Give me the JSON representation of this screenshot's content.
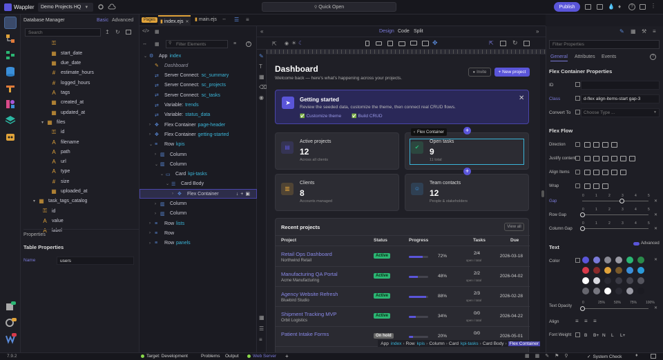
{
  "topbar": {
    "brand": "Wappler",
    "project": "Demo Projects HQ",
    "quick_open": "Quick Open",
    "publish": "Publish"
  },
  "db": {
    "title": "Database Manager",
    "basic": "Basic",
    "advanced": "Advanced",
    "search_placeholder": "Search",
    "fields": [
      {
        "icon": "key",
        "label": ""
      },
      {
        "icon": "date",
        "label": "start_date"
      },
      {
        "icon": "date",
        "label": "due_date"
      },
      {
        "icon": "hash",
        "label": "estimate_hours"
      },
      {
        "icon": "hash",
        "label": "logged_hours"
      },
      {
        "icon": "text",
        "label": "tags"
      },
      {
        "icon": "date",
        "label": "created_at"
      },
      {
        "icon": "date",
        "label": "updated_at"
      }
    ],
    "files_table": "files",
    "files_fields": [
      {
        "icon": "key",
        "label": "id"
      },
      {
        "icon": "text",
        "label": "filename"
      },
      {
        "icon": "text",
        "label": "path"
      },
      {
        "icon": "text",
        "label": "url"
      },
      {
        "icon": "text",
        "label": "type"
      },
      {
        "icon": "hash",
        "label": "size"
      },
      {
        "icon": "date",
        "label": "uploaded_at"
      }
    ],
    "tags_table": "task_tags_catalog",
    "tags_fields": [
      {
        "icon": "key",
        "label": "id"
      },
      {
        "icon": "text",
        "label": "value"
      },
      {
        "icon": "text",
        "label": "label"
      }
    ],
    "properties": "Properties",
    "table_properties": "Table Properties",
    "name_label": "Name",
    "name_value": "users"
  },
  "tabs": {
    "pages": "Pages",
    "index": "index.ejs",
    "main": "main.ejs"
  },
  "structure": {
    "filter_placeholder": "Filter Elements",
    "nodes": [
      {
        "d": 0,
        "t": "App",
        "s": "index",
        "c": "#c9c9d4",
        "open": true
      },
      {
        "d": 1,
        "t": "Dashboard",
        "s": "",
        "c": "#9a9aa8",
        "italic": true
      },
      {
        "d": 1,
        "t": "Server Connect:",
        "s": "sc_summary",
        "c": "#c9c9d4"
      },
      {
        "d": 1,
        "t": "Server Connect:",
        "s": "sc_projects",
        "c": "#c9c9d4"
      },
      {
        "d": 1,
        "t": "Server Connect:",
        "s": "sc_tasks",
        "c": "#c9c9d4"
      },
      {
        "d": 1,
        "t": "Variable:",
        "s": "trends",
        "c": "#c9c9d4"
      },
      {
        "d": 1,
        "t": "Variable:",
        "s": "status_data",
        "c": "#c9c9d4"
      },
      {
        "d": 1,
        "t": "Flex Container",
        "s": "page-header",
        "c": "#c9c9d4",
        "arrow": "r"
      },
      {
        "d": 1,
        "t": "Flex Container",
        "s": "getting-started",
        "c": "#c9c9d4",
        "arrow": "r"
      },
      {
        "d": 1,
        "t": "Row",
        "s": "kpis",
        "c": "#c9c9d4",
        "arrow": "d"
      },
      {
        "d": 2,
        "t": "Column",
        "s": "",
        "c": "#c9c9d4",
        "arrow": "r"
      },
      {
        "d": 2,
        "t": "Column",
        "s": "",
        "c": "#c9c9d4",
        "arrow": "d"
      },
      {
        "d": 3,
        "t": "Card",
        "s": "kpi-tasks",
        "c": "#c9c9d4",
        "arrow": "d"
      },
      {
        "d": 4,
        "t": "Card Body",
        "s": "",
        "c": "#c9c9d4",
        "arrow": "d"
      },
      {
        "d": 5,
        "t": "Flex Container",
        "s": "",
        "c": "#c9c9d4",
        "arrow": "r",
        "sel": true
      },
      {
        "d": 2,
        "t": "Column",
        "s": "",
        "c": "#c9c9d4",
        "arrow": "r"
      },
      {
        "d": 2,
        "t": "Column",
        "s": "",
        "c": "#c9c9d4",
        "arrow": "r"
      },
      {
        "d": 1,
        "t": "Row",
        "s": "lists",
        "c": "#c9c9d4",
        "arrow": "r"
      },
      {
        "d": 1,
        "t": "Row",
        "s": "",
        "c": "#c9c9d4",
        "arrow": "r"
      },
      {
        "d": 1,
        "t": "Row",
        "s": "panels",
        "c": "#c9c9d4",
        "arrow": "r"
      }
    ]
  },
  "view": {
    "design": "Design",
    "code": "Code",
    "split": "Split"
  },
  "dash": {
    "title": "Dashboard",
    "subtitle": "Welcome back — here's what's happening across your projects.",
    "invite": "Invite",
    "new_project": "+ New project",
    "gs_title": "Getting started",
    "gs_text": "Review the seeded data, customize the theme, then connect real CRUD flows.",
    "gs_link1": "Customize theme",
    "gs_link2": "Build CRUD",
    "flex_tooltip": "Flex Container",
    "kpis": [
      {
        "label": "Active projects",
        "value": "12",
        "sub": "Across all clients",
        "color": "#5a55d9"
      },
      {
        "label": "Open tasks",
        "value": "9",
        "sub": "11 total",
        "color": "#2bb673"
      },
      {
        "label": "Clients",
        "value": "8",
        "sub": "Accounts managed",
        "color": "#e0a33a"
      },
      {
        "label": "Team contacts",
        "value": "12",
        "sub": "People & stakeholders",
        "color": "#3b8fd9"
      }
    ],
    "recent_title": "Recent projects",
    "view_all": "View all",
    "cols": [
      "Project",
      "Status",
      "Progress",
      "Tasks",
      "Due"
    ],
    "rows": [
      {
        "name": "Retail Ops Dashboard",
        "client": "Northwind Retail",
        "status": "Active",
        "progress": 72,
        "pct": "72%",
        "tasks": "2/4",
        "tsub": "open / total",
        "due": "2026-03-18"
      },
      {
        "name": "Manufacturing QA Portal",
        "client": "Acme Manufacturing",
        "status": "Active",
        "progress": 48,
        "pct": "48%",
        "tasks": "2/2",
        "tsub": "open / total",
        "due": "2026-04-02"
      },
      {
        "name": "Agency Website Refresh",
        "client": "Bluebird Studio",
        "status": "Active",
        "progress": 88,
        "pct": "88%",
        "tasks": "2/3",
        "tsub": "open / total",
        "due": "2026-02-28"
      },
      {
        "name": "Shipment Tracking MVP",
        "client": "Orbit Logistics",
        "status": "Active",
        "progress": 34,
        "pct": "34%",
        "tasks": "0/0",
        "tsub": "open / total",
        "due": "2026-04-22"
      },
      {
        "name": "Patient Intake Forms",
        "client": "",
        "status": "On hold",
        "progress": 20,
        "pct": "20%",
        "tasks": "0/0",
        "tsub": "",
        "due": "2026-05-01"
      }
    ],
    "breadcrumb": [
      "App",
      "index",
      "Row",
      "kpis",
      "Column",
      "Card",
      "kpi-tasks",
      "Card Body",
      "Flex Container"
    ]
  },
  "props": {
    "filter_placeholder": "Filter Properties",
    "tab_general": "General",
    "tab_attributes": "Attributes",
    "tab_events": "Events",
    "section1": "Flex Container Properties",
    "id_label": "ID",
    "class_label": "Class",
    "class_value": "d-flex align-items-start gap-3",
    "convert_label": "Convert To",
    "convert_placeholder": "Choose Type ...",
    "flex_flow": "Flex Flow",
    "direction": "Direction",
    "justify": "Justify content",
    "align_items": "Align Items",
    "wrap": "Wrap",
    "gap": "Gap",
    "row_gap": "Row Gap",
    "col_gap": "Column Gap",
    "gap_ticks": [
      "0",
      "1",
      "2",
      "3",
      "4",
      "5"
    ],
    "gap_value": 3,
    "text_section": "Text",
    "advanced": "Advanced",
    "color": "Color",
    "swatches": [
      "#5a55d9",
      "#7a7ad9",
      "#8a8a94",
      "#9a9aa4",
      "#2bb673",
      "#2a8a4a",
      "#d93a4a",
      "#8a2a2a",
      "#e0a33a",
      "#7a5a2a",
      "#3b8fd9",
      "#2a9ad9",
      "#ffffff",
      "#d9d9e0",
      "#2a2a33",
      "#3a3a44",
      "#44444e",
      "#55555e",
      "#66666e",
      "#777780",
      "#ffffff",
      "#2a2a33",
      "#9a9aa4",
      "#1b1b22"
    ],
    "text_opacity": "Text Opacity",
    "opacity_ticks": [
      "0",
      "25%",
      "50%",
      "75%",
      "100%"
    ],
    "align": "Align",
    "font_weight": "Font Weight",
    "weights": [
      "B",
      "B+",
      "N",
      "L",
      "L+"
    ]
  },
  "status": {
    "version": "7.9.2",
    "target": "Target: Development",
    "problems": "Problems",
    "output": "Output",
    "webserver": "Web Server",
    "system_check": "System Check"
  }
}
